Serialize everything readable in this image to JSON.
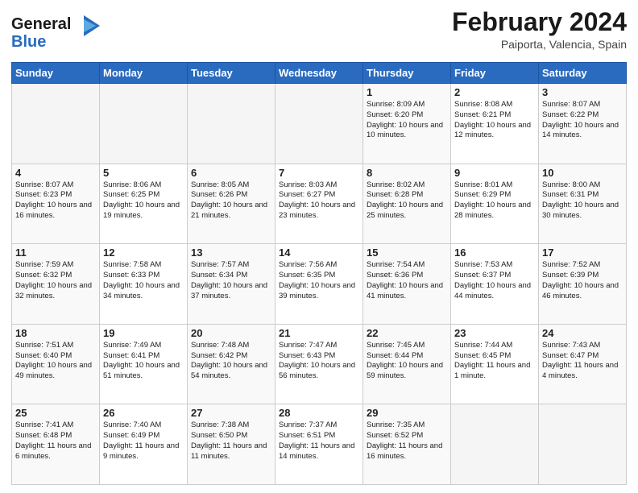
{
  "header": {
    "logo_line1": "General",
    "logo_line2": "Blue",
    "title": "February 2024",
    "subtitle": "Paiporta, Valencia, Spain"
  },
  "weekdays": [
    "Sunday",
    "Monday",
    "Tuesday",
    "Wednesday",
    "Thursday",
    "Friday",
    "Saturday"
  ],
  "weeks": [
    [
      {
        "day": "",
        "info": ""
      },
      {
        "day": "",
        "info": ""
      },
      {
        "day": "",
        "info": ""
      },
      {
        "day": "",
        "info": ""
      },
      {
        "day": "1",
        "info": "Sunrise: 8:09 AM\nSunset: 6:20 PM\nDaylight: 10 hours\nand 10 minutes."
      },
      {
        "day": "2",
        "info": "Sunrise: 8:08 AM\nSunset: 6:21 PM\nDaylight: 10 hours\nand 12 minutes."
      },
      {
        "day": "3",
        "info": "Sunrise: 8:07 AM\nSunset: 6:22 PM\nDaylight: 10 hours\nand 14 minutes."
      }
    ],
    [
      {
        "day": "4",
        "info": "Sunrise: 8:07 AM\nSunset: 6:23 PM\nDaylight: 10 hours\nand 16 minutes."
      },
      {
        "day": "5",
        "info": "Sunrise: 8:06 AM\nSunset: 6:25 PM\nDaylight: 10 hours\nand 19 minutes."
      },
      {
        "day": "6",
        "info": "Sunrise: 8:05 AM\nSunset: 6:26 PM\nDaylight: 10 hours\nand 21 minutes."
      },
      {
        "day": "7",
        "info": "Sunrise: 8:03 AM\nSunset: 6:27 PM\nDaylight: 10 hours\nand 23 minutes."
      },
      {
        "day": "8",
        "info": "Sunrise: 8:02 AM\nSunset: 6:28 PM\nDaylight: 10 hours\nand 25 minutes."
      },
      {
        "day": "9",
        "info": "Sunrise: 8:01 AM\nSunset: 6:29 PM\nDaylight: 10 hours\nand 28 minutes."
      },
      {
        "day": "10",
        "info": "Sunrise: 8:00 AM\nSunset: 6:31 PM\nDaylight: 10 hours\nand 30 minutes."
      }
    ],
    [
      {
        "day": "11",
        "info": "Sunrise: 7:59 AM\nSunset: 6:32 PM\nDaylight: 10 hours\nand 32 minutes."
      },
      {
        "day": "12",
        "info": "Sunrise: 7:58 AM\nSunset: 6:33 PM\nDaylight: 10 hours\nand 34 minutes."
      },
      {
        "day": "13",
        "info": "Sunrise: 7:57 AM\nSunset: 6:34 PM\nDaylight: 10 hours\nand 37 minutes."
      },
      {
        "day": "14",
        "info": "Sunrise: 7:56 AM\nSunset: 6:35 PM\nDaylight: 10 hours\nand 39 minutes."
      },
      {
        "day": "15",
        "info": "Sunrise: 7:54 AM\nSunset: 6:36 PM\nDaylight: 10 hours\nand 41 minutes."
      },
      {
        "day": "16",
        "info": "Sunrise: 7:53 AM\nSunset: 6:37 PM\nDaylight: 10 hours\nand 44 minutes."
      },
      {
        "day": "17",
        "info": "Sunrise: 7:52 AM\nSunset: 6:39 PM\nDaylight: 10 hours\nand 46 minutes."
      }
    ],
    [
      {
        "day": "18",
        "info": "Sunrise: 7:51 AM\nSunset: 6:40 PM\nDaylight: 10 hours\nand 49 minutes."
      },
      {
        "day": "19",
        "info": "Sunrise: 7:49 AM\nSunset: 6:41 PM\nDaylight: 10 hours\nand 51 minutes."
      },
      {
        "day": "20",
        "info": "Sunrise: 7:48 AM\nSunset: 6:42 PM\nDaylight: 10 hours\nand 54 minutes."
      },
      {
        "day": "21",
        "info": "Sunrise: 7:47 AM\nSunset: 6:43 PM\nDaylight: 10 hours\nand 56 minutes."
      },
      {
        "day": "22",
        "info": "Sunrise: 7:45 AM\nSunset: 6:44 PM\nDaylight: 10 hours\nand 59 minutes."
      },
      {
        "day": "23",
        "info": "Sunrise: 7:44 AM\nSunset: 6:45 PM\nDaylight: 11 hours\nand 1 minute."
      },
      {
        "day": "24",
        "info": "Sunrise: 7:43 AM\nSunset: 6:47 PM\nDaylight: 11 hours\nand 4 minutes."
      }
    ],
    [
      {
        "day": "25",
        "info": "Sunrise: 7:41 AM\nSunset: 6:48 PM\nDaylight: 11 hours\nand 6 minutes."
      },
      {
        "day": "26",
        "info": "Sunrise: 7:40 AM\nSunset: 6:49 PM\nDaylight: 11 hours\nand 9 minutes."
      },
      {
        "day": "27",
        "info": "Sunrise: 7:38 AM\nSunset: 6:50 PM\nDaylight: 11 hours\nand 11 minutes."
      },
      {
        "day": "28",
        "info": "Sunrise: 7:37 AM\nSunset: 6:51 PM\nDaylight: 11 hours\nand 14 minutes."
      },
      {
        "day": "29",
        "info": "Sunrise: 7:35 AM\nSunset: 6:52 PM\nDaylight: 11 hours\nand 16 minutes."
      },
      {
        "day": "",
        "info": ""
      },
      {
        "day": "",
        "info": ""
      }
    ]
  ]
}
